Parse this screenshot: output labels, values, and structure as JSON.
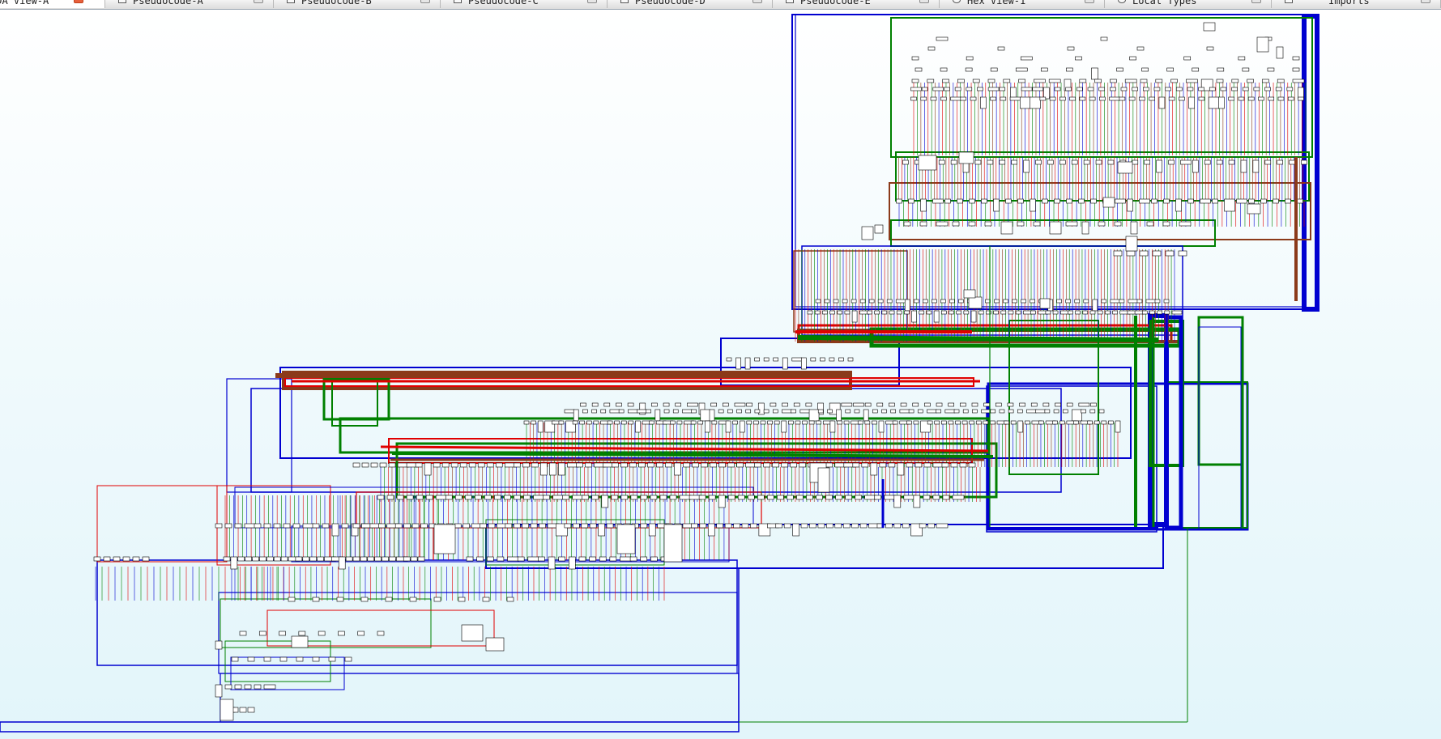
{
  "tabs": [
    {
      "label": "IDA View-A",
      "active": true
    },
    {
      "label": "Pseudocode-A",
      "active": false
    },
    {
      "label": "Pseudocode-B",
      "active": false
    },
    {
      "label": "Pseudocode-C",
      "active": false
    },
    {
      "label": "Pseudocode-D",
      "active": false
    },
    {
      "label": "Pseudocode-E",
      "active": false
    },
    {
      "label": "Hex View-1",
      "active": false
    },
    {
      "label": "Local Types",
      "active": false
    },
    {
      "label": "Imports",
      "active": false
    }
  ],
  "graph": {
    "view": "control-flow graph overview",
    "edge_colors": {
      "true_branch": "#008000",
      "false_branch": "#e00000",
      "unconditional": "#0000d0"
    },
    "node_fill": "#ffffff",
    "node_border": "#000000",
    "background": "#e4f6fb"
  }
}
